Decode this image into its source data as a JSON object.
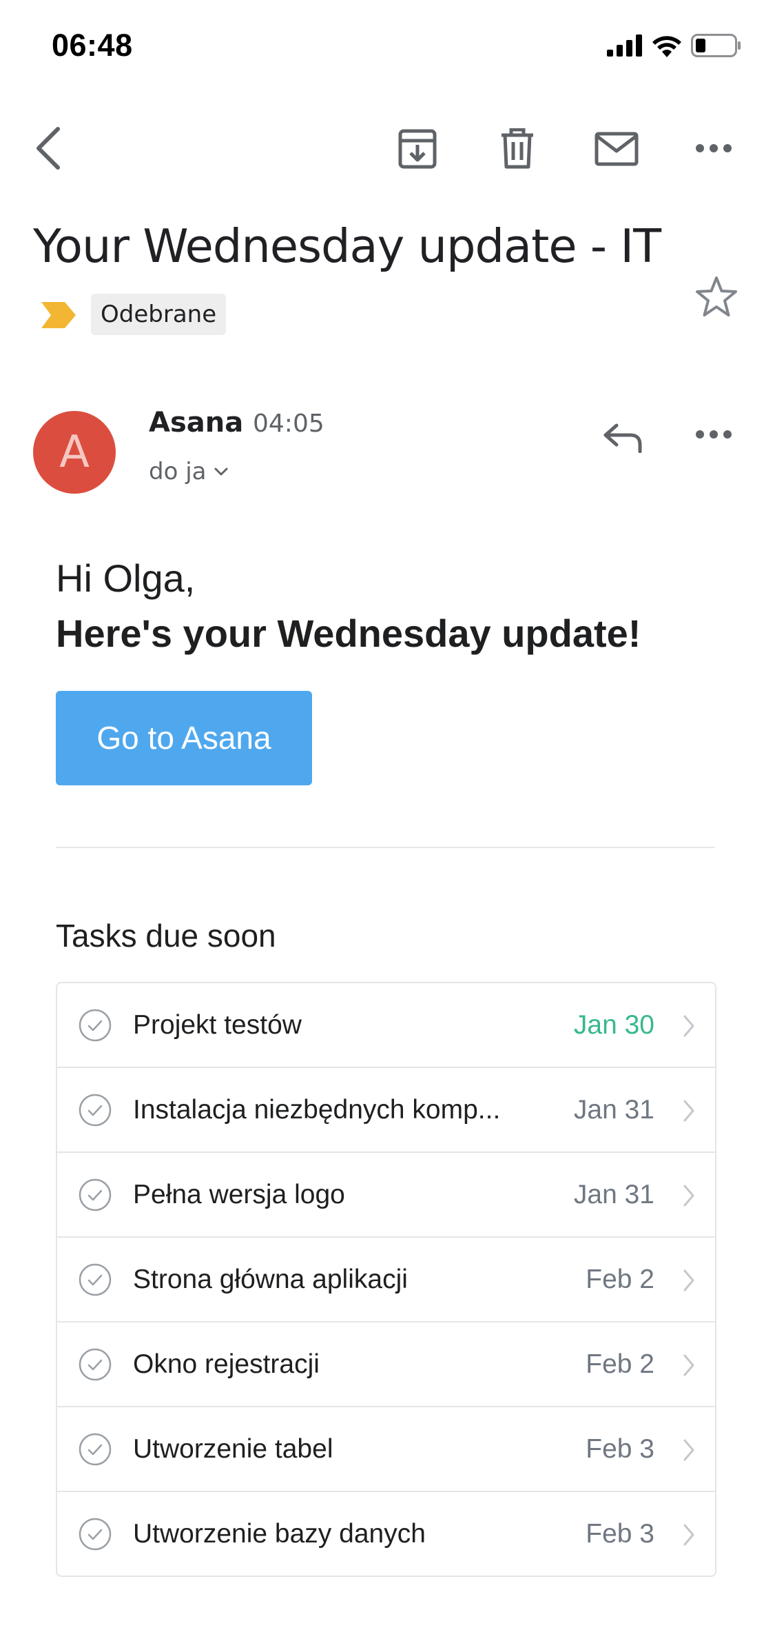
{
  "status_bar": {
    "time": "06:48",
    "icons": [
      "signal-icon",
      "wifi-icon",
      "battery-icon"
    ]
  },
  "toolbar": {
    "icons": [
      "back-icon",
      "archive-icon",
      "trash-icon",
      "mail-icon",
      "more-icon"
    ]
  },
  "email": {
    "subject": "Your Wednesday update - IT",
    "label": "Odebrane",
    "important_marker_color": "#f2b632",
    "sender": {
      "avatar_letter": "A",
      "avatar_color": "#db4e3f",
      "name": "Asana",
      "time": "04:05",
      "recipient": "do ja"
    }
  },
  "body": {
    "greeting": "Hi Olga,",
    "headline": "Here's your Wednesday update!",
    "cta_label": "Go to Asana",
    "cta_color": "#4fa8ee",
    "section_title": "Tasks due soon",
    "tasks": [
      {
        "name": "Projekt testów",
        "date": "Jan 30",
        "highlight": true
      },
      {
        "name": "Instalacja niezbędnych komp...",
        "date": "Jan 31",
        "highlight": false
      },
      {
        "name": "Pełna wersja logo",
        "date": "Jan 31",
        "highlight": false
      },
      {
        "name": "Strona główna aplikacji",
        "date": "Feb 2",
        "highlight": false
      },
      {
        "name": "Okno rejestracji",
        "date": "Feb 2",
        "highlight": false
      },
      {
        "name": "Utworzenie tabel",
        "date": "Feb 3",
        "highlight": false
      },
      {
        "name": "Utworzenie bazy danych",
        "date": "Feb 3",
        "highlight": false
      }
    ]
  }
}
